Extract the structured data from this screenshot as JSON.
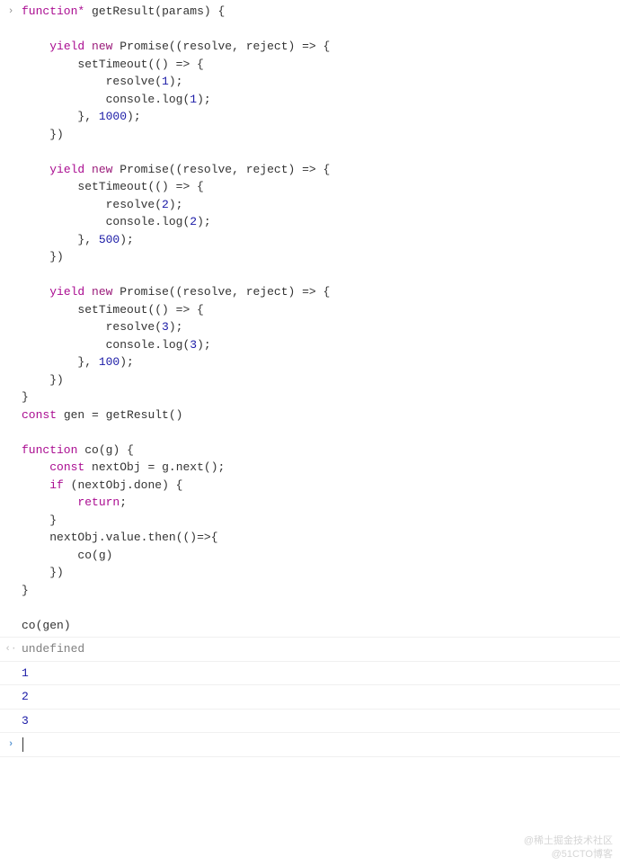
{
  "icons": {
    "input_prompt": "›",
    "output_prompt": "‹·",
    "active_prompt": "›"
  },
  "code": {
    "l1": "function* getResult(params) {",
    "l2": "",
    "l3": "    yield new Promise((resolve, reject) => {",
    "l4": "        setTimeout(() => {",
    "l5": "            resolve(1);",
    "l6": "            console.log(1);",
    "l7": "        }, 1000);",
    "l8": "    })",
    "l9": "",
    "l10": "    yield new Promise((resolve, reject) => {",
    "l11": "        setTimeout(() => {",
    "l12": "            resolve(2);",
    "l13": "            console.log(2);",
    "l14": "        }, 500);",
    "l15": "    })",
    "l16": "",
    "l17": "    yield new Promise((resolve, reject) => {",
    "l18": "        setTimeout(() => {",
    "l19": "            resolve(3);",
    "l20": "            console.log(3);",
    "l21": "        }, 100);",
    "l22": "    })",
    "l23": "}",
    "l24": "const gen = getResult()",
    "l25": "",
    "l26": "function co(g) {",
    "l27": "    const nextObj = g.next();",
    "l28": "    if (nextObj.done) {",
    "l29": "        return;",
    "l30": "    }",
    "l31": "    nextObj.value.then(()=>{",
    "l32": "        co(g)",
    "l33": "    })",
    "l34": "}",
    "l35": "",
    "l36": "co(gen)"
  },
  "output": {
    "undefined": "undefined",
    "log1": "1",
    "log2": "2",
    "log3": "3"
  },
  "tokens": {
    "function_star": "function*",
    "function": "function",
    "yield": "yield",
    "new": "new",
    "const": "const",
    "if": "if",
    "return": "return",
    "Promise": "Promise",
    "setTimeout": "setTimeout",
    "resolve": "resolve",
    "reject": "reject",
    "console": "console",
    "log": "log",
    "getResult": "getResult",
    "params": "params",
    "gen": "gen",
    "co": "co",
    "g": "g",
    "nextObj": "nextObj",
    "next": "next",
    "done": "done",
    "value": "value",
    "then": "then",
    "n1": "1",
    "n2": "2",
    "n3": "3",
    "n1000": "1000",
    "n500": "500",
    "n100": "100"
  },
  "watermark": {
    "line1": "@稀土掘金技术社区",
    "line2": "@51CTO博客"
  }
}
